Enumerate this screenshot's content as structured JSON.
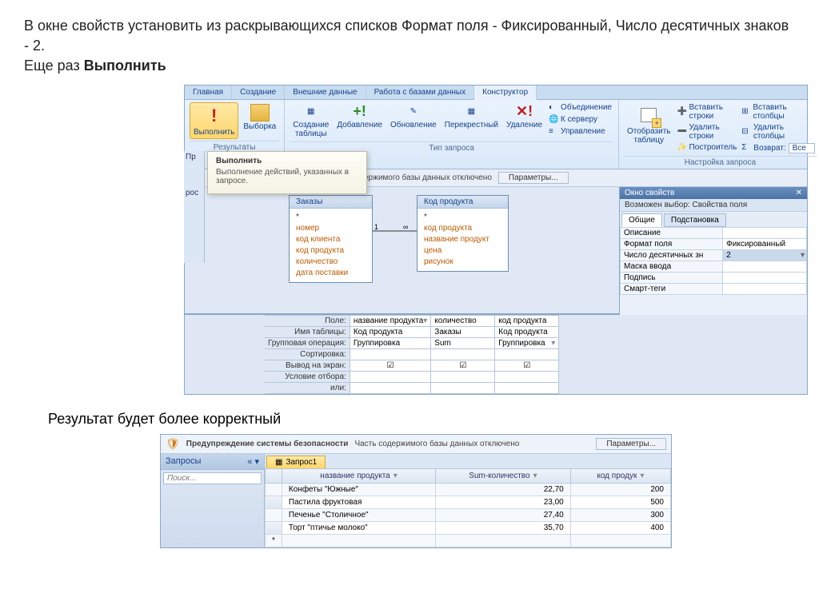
{
  "instruction": {
    "line1": "В окне свойств установить из раскрывающихся списков Формат поля - Фиксированный, Число десятичных знаков -  2.",
    "line2_prefix": "Еще раз ",
    "line2_bold": "Выполнить"
  },
  "tabs": [
    "Главная",
    "Создание",
    "Внешние данные",
    "Работа с базами данных",
    "Конструктор"
  ],
  "ribbon": {
    "run": "Выполнить",
    "select": "Выборка",
    "maketable": "Создание таблицы",
    "append": "Добавление",
    "update": "Обновление",
    "crosstab": "Перекрестный",
    "delete": "Удаление",
    "union": "Объединение",
    "passthrough": "К серверу",
    "datadef": "Управление",
    "showtable": "Отобразить таблицу",
    "insrows": "Вставить строки",
    "delrows": "Удалить строки",
    "builder": "Построитель",
    "inscols": "Вставить столбцы",
    "delcols": "Удалить столбцы",
    "return_lbl": "Возврат:",
    "return_val": "Все",
    "grp_results": "Результаты",
    "grp_querytype": "Тип запроса",
    "grp_querysetup": "Настройка запроса"
  },
  "tooltip": {
    "title": "Выполнить",
    "body": "Выполнение действий, указанных в запросе."
  },
  "leftstub": {
    "a": "Пр",
    "b": "рос"
  },
  "warn": {
    "title": "Предупреждение системы безопасности",
    "msg_tail": "ержимого базы данных отключено",
    "msg_full": "Часть содержимого базы данных отключено",
    "params": "Параметры..."
  },
  "tables": {
    "orders": {
      "title": "Заказы",
      "fields": [
        "номер",
        "код клиента",
        "код продукта",
        "количество",
        "дата поставки"
      ]
    },
    "product": {
      "title": "Код продукта",
      "fields": [
        "код продукта",
        "название продукт",
        "цена",
        "рисунок"
      ]
    }
  },
  "propsheet": {
    "title": "Окно свойств",
    "sub": "Возможен выбор:  Свойства поля",
    "tab1": "Общие",
    "tab2": "Подстановка",
    "rows": {
      "desc": "Описание",
      "format": "Формат поля",
      "format_val": "Фиксированный",
      "decimals": "Число десятичных зн",
      "decimals_val": "2",
      "mask": "Маска ввода",
      "caption": "Подпись",
      "smart": "Смарт-теги"
    }
  },
  "designgrid": {
    "labels": {
      "field": "Поле:",
      "table": "Имя таблицы:",
      "total": "Групповая операция:",
      "sort": "Сортировка:",
      "show": "Вывод на экран:",
      "criteria": "Условие отбора:",
      "or": "или:"
    },
    "cols": [
      {
        "field": "название продукта",
        "table": "Код продукта",
        "total": "Группировка",
        "show": true
      },
      {
        "field": "количество",
        "table": "Заказы",
        "total": "Sum",
        "show": true
      },
      {
        "field": "код продукта",
        "table": "Код продукта",
        "total": "Группировка",
        "show": true
      }
    ]
  },
  "result_text": "Результат будет более корректный",
  "nav": {
    "title": "Запросы",
    "search": "Поиск..."
  },
  "query_tab": "Запрос1",
  "result_cols": [
    "название продукта",
    "Sum-количество",
    "код продук"
  ],
  "result_rows": [
    {
      "name": "Конфеты \"Южные\"",
      "sum": "22,70",
      "code": "200"
    },
    {
      "name": "Пастила фруктовая",
      "sum": "23,00",
      "code": "500"
    },
    {
      "name": "Печенье \"Столичное\"",
      "sum": "27,40",
      "code": "300"
    },
    {
      "name": "Торт \"птичье молоко\"",
      "sum": "35,70",
      "code": "400"
    }
  ]
}
